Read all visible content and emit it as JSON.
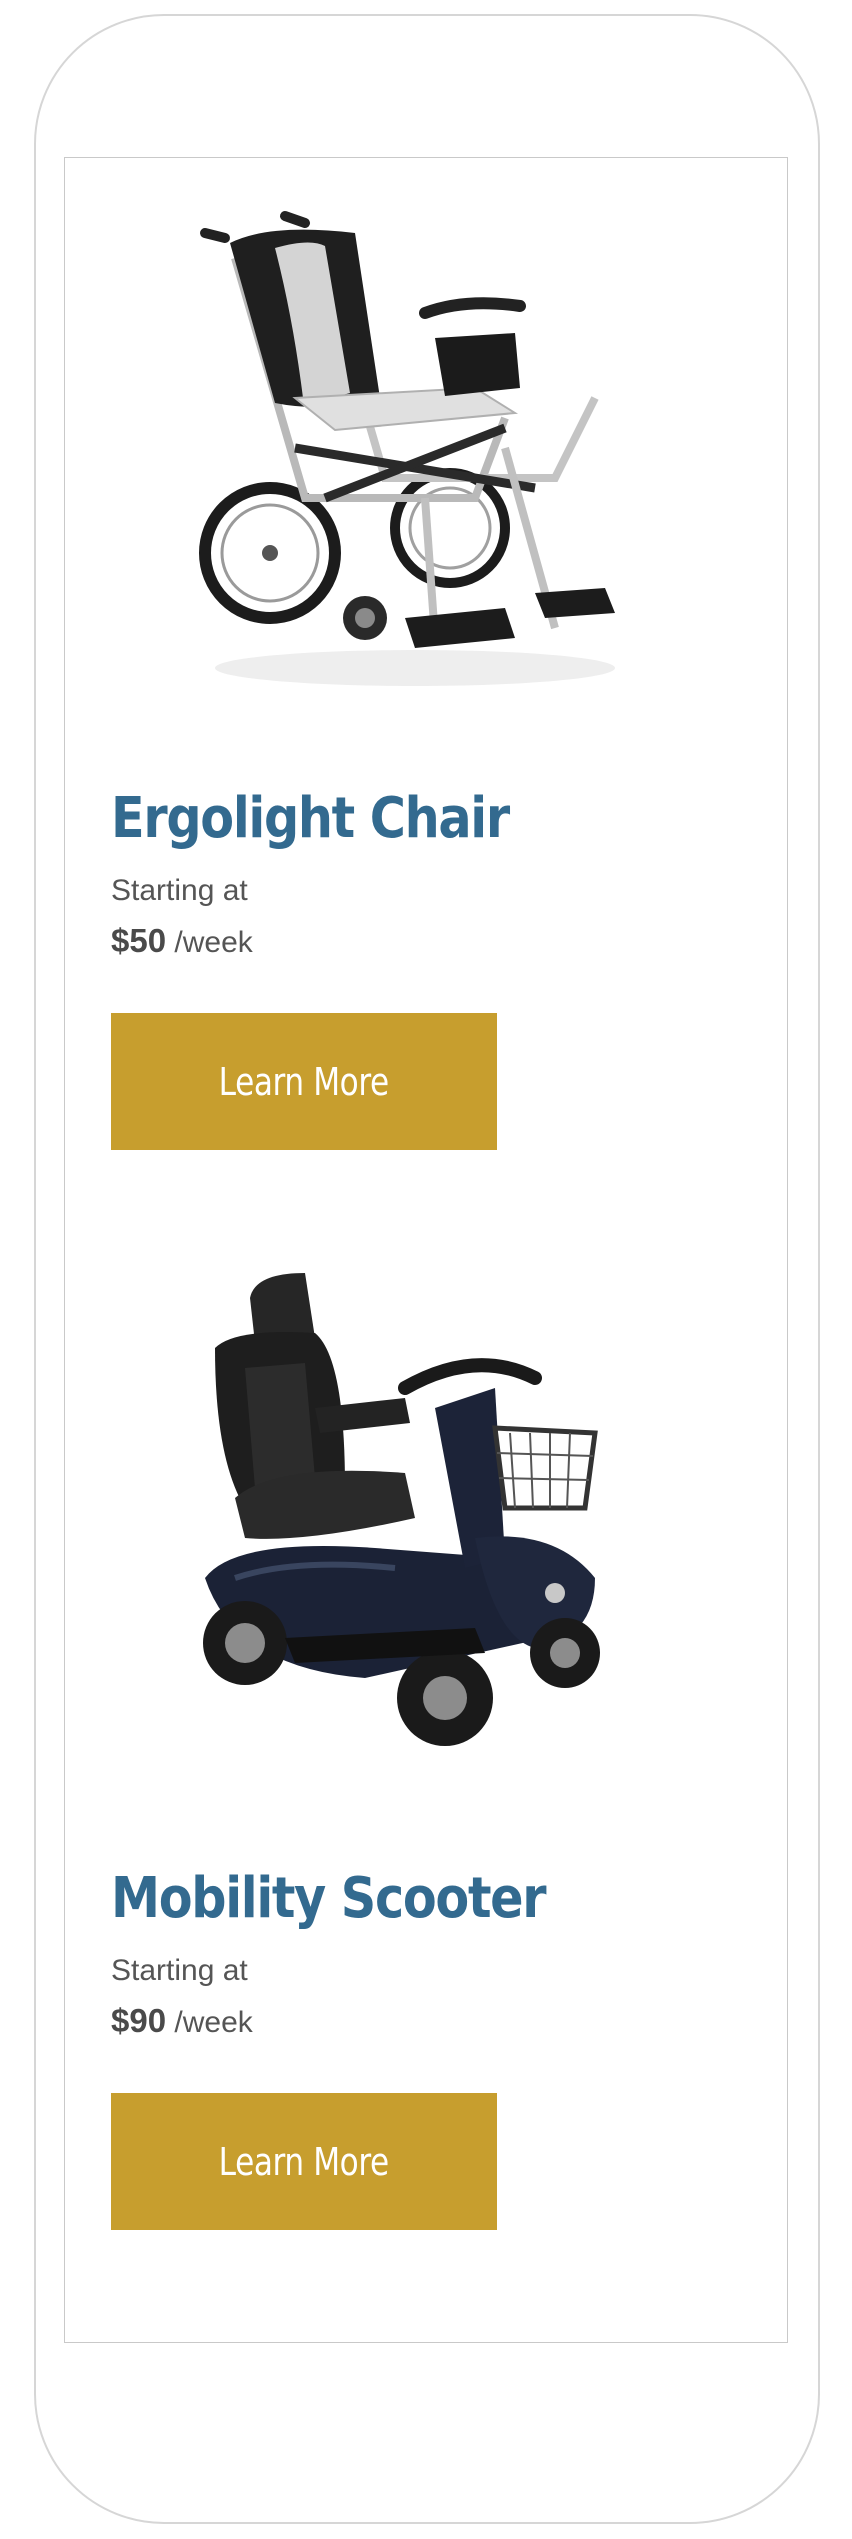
{
  "theme": {
    "title_color": "#336a8f",
    "button_color": "#c79e2e",
    "button_text_color": "#ffffff"
  },
  "products": [
    {
      "title": "Ergolight Chair",
      "image_icon": "wheelchair-icon",
      "starting_label": "Starting at",
      "price": "$50",
      "price_unit": "/week",
      "button_label": "Learn More"
    },
    {
      "title": "Mobility Scooter",
      "image_icon": "mobility-scooter-icon",
      "starting_label": "Starting at",
      "price": "$90",
      "price_unit": "/week",
      "button_label": "Learn More"
    }
  ]
}
